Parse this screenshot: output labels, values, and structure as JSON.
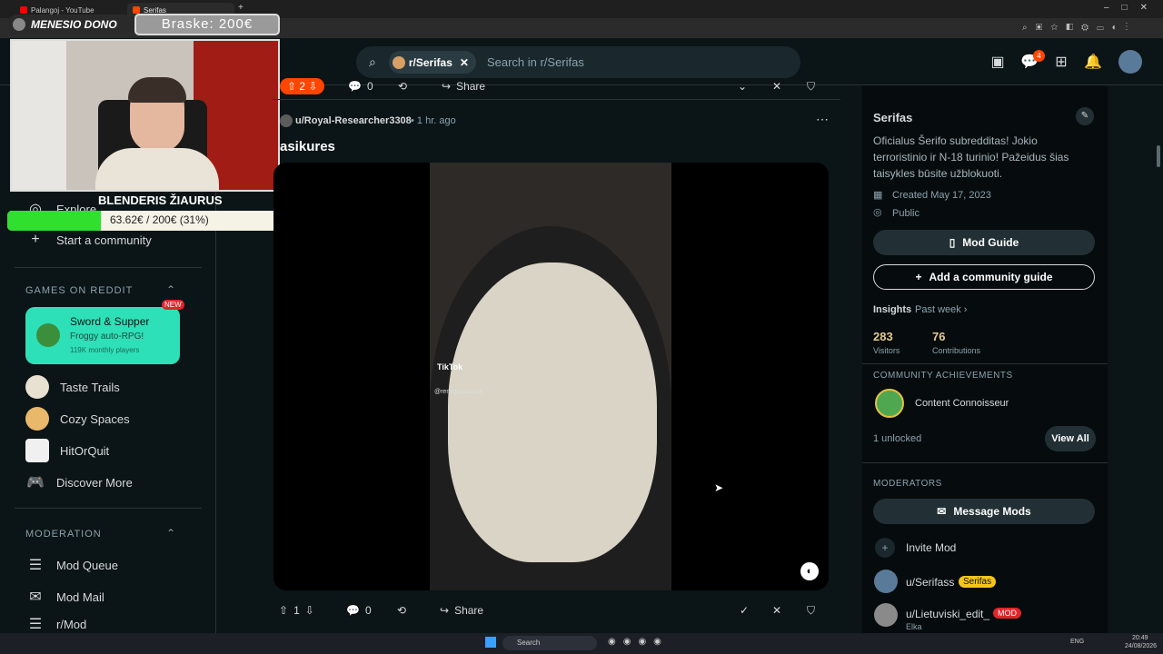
{
  "browser": {
    "tabs": [
      {
        "label": "Palangoj - YouTube",
        "color": "#ff0000"
      },
      {
        "label": "Serifas",
        "color": "#ff4500"
      }
    ]
  },
  "overlay": {
    "donation_title": "MENESIO DONO",
    "goal_badge": "Braske: 200€",
    "streamer_label": "BLENDERIS ŽIAURUS",
    "progress_text": "63.62€ / 200€ (31%)",
    "progress_fraction": 0.31,
    "progress_color": "#2fe02f"
  },
  "header": {
    "search_chip": "r/Serifas",
    "search_placeholder": "Search in r/Serifas",
    "notif_count": "4"
  },
  "sidebar": {
    "explore": "Explore",
    "start_community": "Start a community",
    "games_heading": "GAMES ON REDDIT",
    "featured_game": {
      "title": "Sword & Supper",
      "subtitle": "Froggy auto-RPG!",
      "players": "119K monthly players",
      "badge": "NEW"
    },
    "games": [
      {
        "label": "Taste Trails"
      },
      {
        "label": "Cozy Spaces"
      },
      {
        "label": "HitOrQuit"
      },
      {
        "label": "Discover More"
      }
    ],
    "moderation_heading": "MODERATION",
    "moderation": [
      {
        "label": "Mod Queue"
      },
      {
        "label": "Mod Mail"
      },
      {
        "label": "r/Mod"
      }
    ]
  },
  "post_prev": {
    "votes": "2",
    "comments": "0",
    "share": "Share"
  },
  "post": {
    "author": "u/Royal-Researcher3308",
    "time": "• 1 hr. ago",
    "title": "asikures",
    "tiktok": "TikTok",
    "tiktok_user": "@remigijusvirsila",
    "votes": "1",
    "comments": "0",
    "share": "Share"
  },
  "community": {
    "name": "Serifas",
    "description": "Oficialus Šerifo subredditas! Jokio terroristinio ir N-18 turinio! Pažeidus šias taisykles būsite užblokuoti.",
    "created": "Created May 17, 2023",
    "visibility": "Public",
    "mod_guide": "Mod Guide",
    "add_guide": "Add a community guide",
    "insights": "Insights",
    "insights_period": "Past week",
    "visitors_value": "283",
    "visitors_label": "Visitors",
    "contrib_value": "76",
    "contrib_label": "Contributions",
    "achievements_heading": "COMMUNITY ACHIEVEMENTS",
    "achievement": "Content Connoisseur",
    "unlocked": "1 unlocked",
    "view_all": "View All",
    "moderators_heading": "MODERATORS",
    "message_mods": "Message Mods",
    "invite_mod": "Invite Mod",
    "mods": [
      {
        "name": "u/Serifass",
        "flair": "Serifas",
        "flair_color": "#f5c518"
      },
      {
        "name": "u/Lietuviski_edit_",
        "flair": "MOD",
        "flair_color": "#e0252b",
        "sub": "Elka"
      }
    ]
  },
  "taskbar": {
    "search": "Search",
    "lang": "ENG",
    "time": "20:49",
    "date": "24/08/2026"
  }
}
